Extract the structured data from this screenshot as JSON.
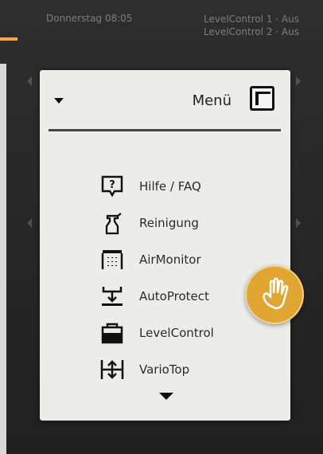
{
  "status": {
    "date": "Donnerstag 08:05",
    "level_control_1": "LevelControl 1 · Aus",
    "level_control_2": "LevelControl 2 · Aus"
  },
  "menu": {
    "title": "Menü",
    "items": [
      {
        "label": "Hilfe / FAQ",
        "icon": "help-icon"
      },
      {
        "label": "Reinigung",
        "icon": "cleaning-spray-icon"
      },
      {
        "label": "AirMonitor",
        "icon": "air-monitor-icon"
      },
      {
        "label": "AutoProtect",
        "icon": "auto-protect-icon"
      },
      {
        "label": "LevelControl",
        "icon": "level-control-icon"
      },
      {
        "label": "VarioTop",
        "icon": "vario-top-icon"
      }
    ]
  },
  "colors": {
    "accent": "#e1a531",
    "menu_background": "#ececea",
    "text": "#2b2b2b"
  }
}
